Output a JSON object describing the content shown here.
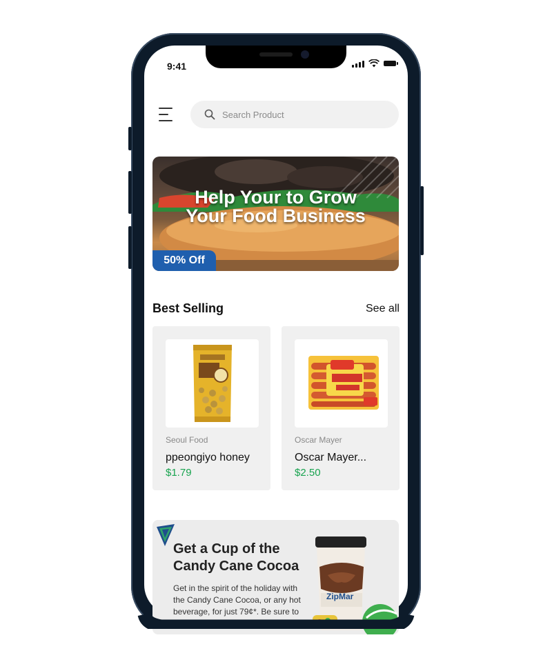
{
  "status_bar": {
    "time": "9:41"
  },
  "header": {
    "menu_icon": "hamburger-menu-icon",
    "search": {
      "placeholder": "Search Product",
      "icon": "search-icon"
    }
  },
  "banner": {
    "title_line1": "Help Your to Grow",
    "title_line2": "Your Food Business",
    "badge": "50% Off"
  },
  "best_selling": {
    "title": "Best Selling",
    "see_all": "See all",
    "products": [
      {
        "brand": "Seoul Food",
        "name": "ppeongiyo honey",
        "price": "$1.79"
      },
      {
        "brand": "Oscar Mayer",
        "name": "Oscar Mayer...",
        "price": "$2.50"
      }
    ]
  },
  "promo": {
    "title": "Get a Cup of the Candy Cane Cocoa",
    "text": "Get in the spirit of the holiday with the Candy Cane Cocoa, or any hot beverage, for just 79¢*. Be sure to",
    "cup_brand": "ZipMar"
  },
  "colors": {
    "price": "#18a34f",
    "badge": "#1f5fae",
    "frame": "#0d1b2a"
  }
}
